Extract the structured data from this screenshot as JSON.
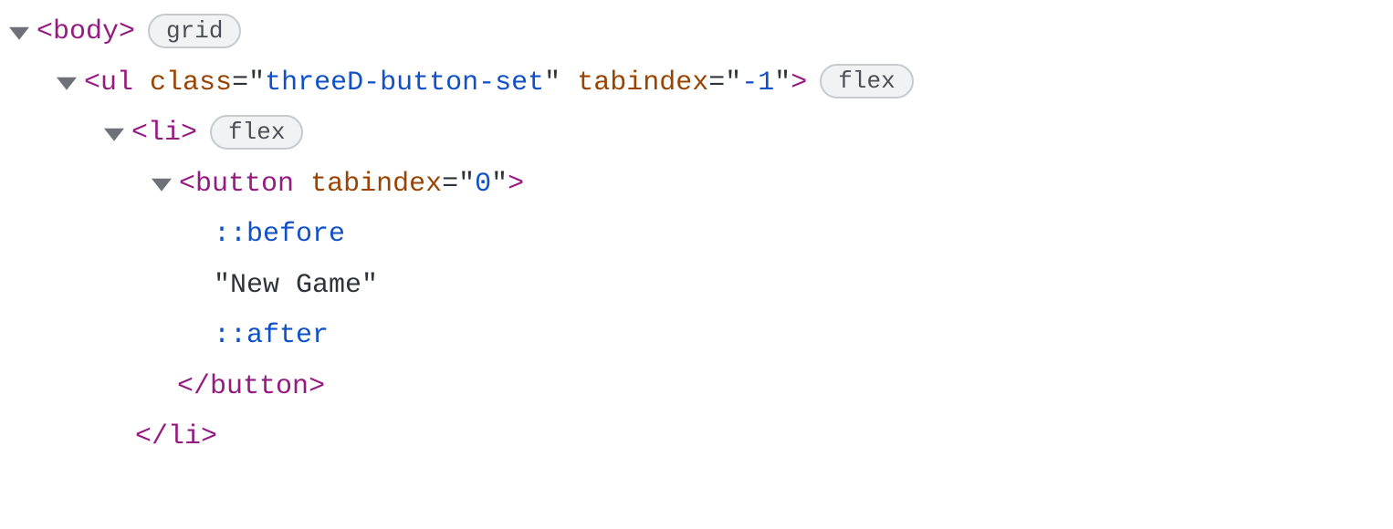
{
  "rows": {
    "body": {
      "open_lt": "<",
      "tag": "body",
      "open_gt": ">",
      "badge": "grid"
    },
    "ul": {
      "open_lt": "<",
      "tag": "ul",
      "attr1_name": "class",
      "eq1": "=",
      "q1a": "\"",
      "attr1_val": "threeD-button-set",
      "q1b": "\"",
      "attr2_name": "tabindex",
      "eq2": "=",
      "q2a": "\"",
      "attr2_val": "-1",
      "q2b": "\"",
      "open_gt": ">",
      "badge": "flex"
    },
    "li": {
      "open_lt": "<",
      "tag": "li",
      "open_gt": ">",
      "badge": "flex"
    },
    "button": {
      "open_lt": "<",
      "tag": "button",
      "attr1_name": "tabindex",
      "eq1": "=",
      "q1a": "\"",
      "attr1_val": "0",
      "q1b": "\"",
      "open_gt": ">"
    },
    "before": {
      "text": "::before"
    },
    "textnode": {
      "text": "\"New Game\""
    },
    "after": {
      "text": "::after"
    },
    "button_close": {
      "open_lt": "<",
      "slash": "/",
      "tag": "button",
      "open_gt": ">"
    },
    "li_close": {
      "open_lt": "<",
      "slash": "/",
      "tag": "li",
      "open_gt": ">"
    }
  }
}
